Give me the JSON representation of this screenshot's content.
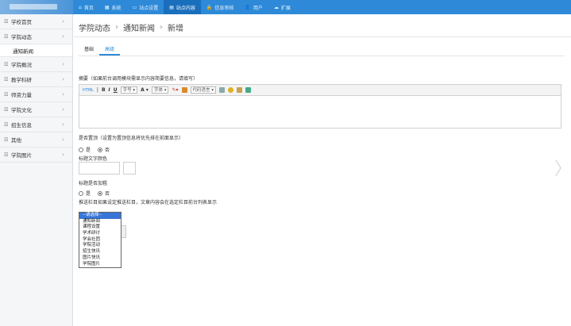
{
  "topnav": {
    "items": [
      {
        "icon": "home-icon",
        "glyph": "⌂",
        "label": "首页"
      },
      {
        "icon": "grid-icon",
        "glyph": "▦",
        "label": "系统"
      },
      {
        "icon": "monitor-icon",
        "glyph": "▭",
        "label": "站点设置"
      },
      {
        "icon": "list-icon",
        "glyph": "▤",
        "label": "站点内容"
      },
      {
        "icon": "lock-icon",
        "glyph": "🔒",
        "label": "信息审核"
      },
      {
        "icon": "user-icon",
        "glyph": "👤",
        "label": "用户"
      },
      {
        "icon": "cloud-icon",
        "glyph": "☁",
        "label": "扩展"
      }
    ],
    "active_index": 3
  },
  "sidebar": {
    "items": [
      {
        "label": "学校首页",
        "chevron": "›"
      },
      {
        "label": "学院动态",
        "chevron": "›",
        "sub": "通知新闻"
      },
      {
        "label": "学院概况",
        "chevron": "›"
      },
      {
        "label": "教学科研",
        "chevron": "›"
      },
      {
        "label": "师资力量",
        "chevron": "›"
      },
      {
        "label": "学院文化",
        "chevron": "›"
      },
      {
        "label": "招生信息",
        "chevron": "›"
      },
      {
        "label": "其他",
        "chevron": "›"
      },
      {
        "label": "学院图片",
        "chevron": "›"
      }
    ]
  },
  "breadcrumb": [
    "学院动态",
    "通知新闻",
    "新增"
  ],
  "tabs": [
    {
      "label": "基础"
    },
    {
      "label": "高级"
    }
  ],
  "form": {
    "summary_label": "摘要（如果前台调用模块需显示内容简要信息，请填写）",
    "toolbar": {
      "html": "HTML",
      "bold": "B",
      "italic": "I",
      "underline": "U",
      "font_size": "字号",
      "font_color": "A",
      "font_family": "字体",
      "code_lang": "代码语言"
    },
    "top_label": "是否置顶（设置为置顶信息将优先排在前面显示）",
    "top_options": [
      "是",
      "否"
    ],
    "title_color_label": "标题文字颜色",
    "title_bold_label": "标题是否加粗",
    "bold_options": [
      "是",
      "否"
    ],
    "push_label": "推送栏目如果设定推送栏目，文章内容会在选定栏目前台列表显示",
    "push_options": [
      "--请选择--",
      "通知新闻",
      "课程设置",
      "学术研讨",
      "学会社团",
      "学院活动",
      "招生快讯",
      "图片快讯",
      "学院图片"
    ]
  },
  "colors": {
    "accent": "#2e8ad8",
    "topbar": "#2e8ad8",
    "nav_active": "#1a6fbd",
    "sidebar_bg": "#f5f6f8",
    "selected_option": "#3875d7"
  },
  "right_arrow_glyph": "〉"
}
